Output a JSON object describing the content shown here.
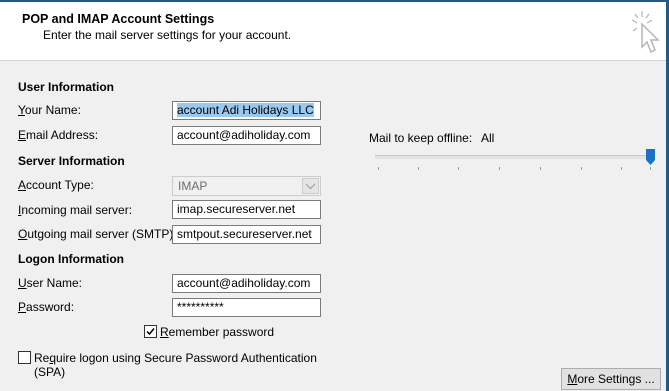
{
  "header": {
    "title": "POP and IMAP Account Settings",
    "subtitle": "Enter the mail server settings for your account."
  },
  "user_info": {
    "heading": "User Information",
    "name_label_u": "Y",
    "name_label_rest": "our Name:",
    "name_value": "account Adi Holidays LLC",
    "email_label_u": "E",
    "email_label_rest": "mail Address:",
    "email_value": "account@adiholiday.com"
  },
  "server_info": {
    "heading": "Server Information",
    "account_type_label_u": "A",
    "account_type_label_rest": "ccount Type:",
    "account_type_value": "IMAP",
    "incoming_label_u": "I",
    "incoming_label_rest": "ncoming mail server:",
    "incoming_value": "imap.secureserver.net",
    "outgoing_label_u": "O",
    "outgoing_label_rest": "utgoing mail server (SMTP):",
    "outgoing_value": "smtpout.secureserver.net"
  },
  "logon_info": {
    "heading": "Logon Information",
    "username_label_u": "U",
    "username_label_rest": "ser Name:",
    "username_value": "account@adiholiday.com",
    "password_label_u": "P",
    "password_label_rest": "assword:",
    "password_value": "**********",
    "remember_label_u": "R",
    "remember_label_rest": "emember password",
    "remember_checked": true,
    "spa_label_pre": "Re",
    "spa_label_u": "q",
    "spa_label_rest": "uire logon using Secure Password Authentication",
    "spa_label_line2": "(SPA)",
    "spa_checked": false
  },
  "offline": {
    "label": "Mail to keep offline:",
    "value": "All",
    "slider_level": 1.0
  },
  "buttons": {
    "more_settings_u": "M",
    "more_settings_rest": "ore Settings ..."
  },
  "colors": {
    "accent": "#1e5a8a",
    "slider_thumb": "#1a72c7",
    "selection": "#99c9ef"
  },
  "icons": {
    "cursor": "pointer-click-icon",
    "combo": "chevron-down-icon",
    "check": "checkmark-icon"
  }
}
